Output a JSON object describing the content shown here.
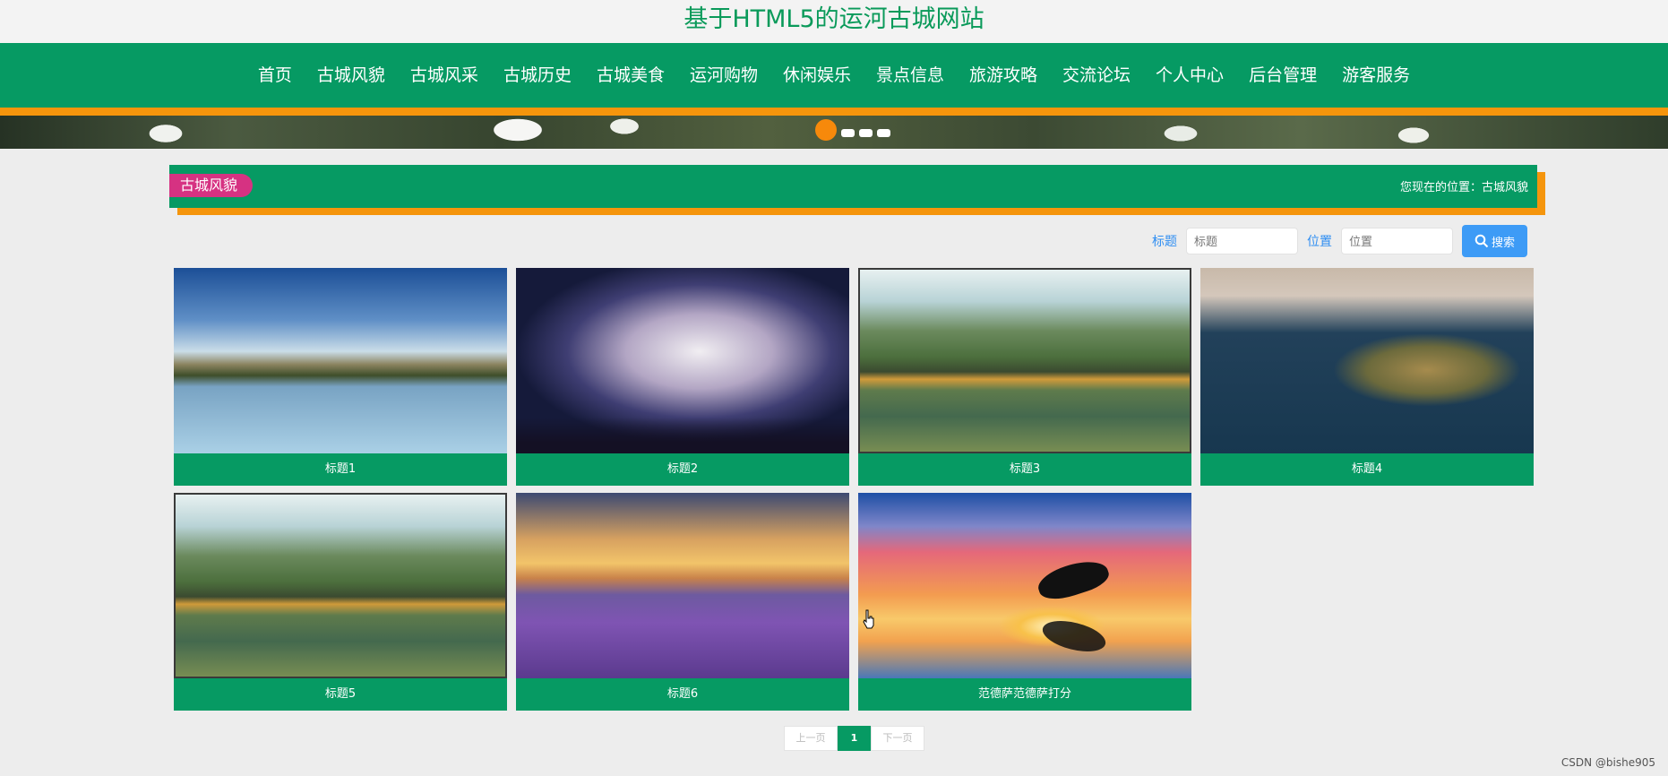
{
  "site_title": "基于HTML5的运河古城网站",
  "nav": [
    "首页",
    "古城风貌",
    "古城风采",
    "古城历史",
    "古城美食",
    "运河购物",
    "休闲娱乐",
    "景点信息",
    "旅游攻略",
    "交流论坛",
    "个人中心",
    "后台管理",
    "游客服务"
  ],
  "section": {
    "tag": "古城风貌",
    "location": "您现在的位置：古城风貌"
  },
  "search": {
    "title_label": "标题",
    "title_placeholder": "标题",
    "position_label": "位置",
    "position_placeholder": "位置",
    "button_label": "搜索"
  },
  "cards": [
    {
      "title": "标题1",
      "image": "lake-mountain-photo"
    },
    {
      "title": "标题2",
      "image": "poster-will-be-you-photo"
    },
    {
      "title": "标题3",
      "image": "stone-bridge-photo"
    },
    {
      "title": "标题4",
      "image": "island-castle-photo"
    },
    {
      "title": "标题5",
      "image": "stone-bridge-photo"
    },
    {
      "title": "标题6",
      "image": "lavender-field-photo"
    },
    {
      "title": "范德萨范德萨打分",
      "image": "dolphin-sunset-photo"
    }
  ],
  "pager": {
    "prev": "上一页",
    "current": "1",
    "next": "下一页"
  },
  "watermark": "CSDN @bishe905",
  "colors": {
    "primary": "#069a63",
    "accent": "#f5950c",
    "tag": "#d63282",
    "link": "#2f8ef2"
  }
}
